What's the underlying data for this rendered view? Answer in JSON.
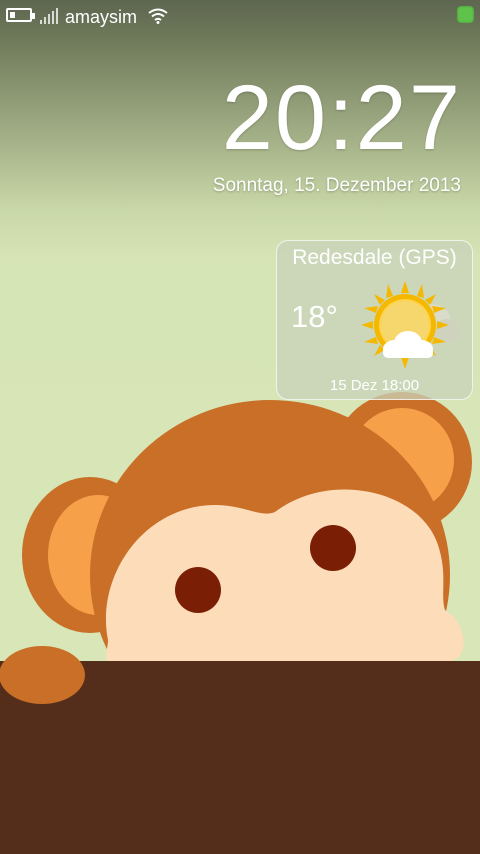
{
  "statusbar": {
    "carrier": "amaysim",
    "battery_level": 0.3,
    "icons": [
      "battery-icon",
      "signal-icon",
      "wifi-icon",
      "notification-icon"
    ],
    "notification_color": "#5fc24a"
  },
  "lockscreen": {
    "time": "20:27",
    "date": "Sonntag, 15. Dezember 2013"
  },
  "weather": {
    "location": "Redesdale (GPS)",
    "temperature": "18°",
    "updated": "15 Dez 18:00",
    "icon": "partly-cloudy-icon"
  },
  "wallpaper": {
    "subject": "monkey-illustration",
    "colors": {
      "fur": "#c96f28",
      "ear_inner": "#f6a04a",
      "face": "#fddcb9",
      "eyes": "#7a1f05",
      "wall": "#542e1a",
      "background": "#d9e6b9"
    }
  }
}
